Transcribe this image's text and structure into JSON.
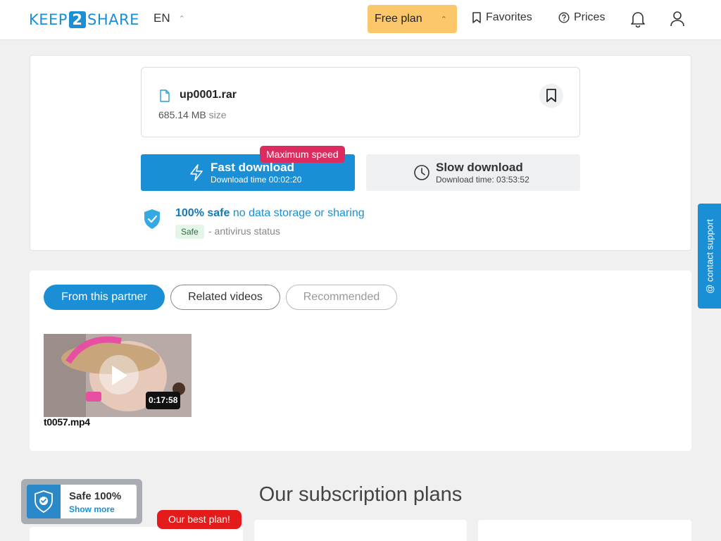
{
  "header": {
    "logo_left": "KEEP",
    "logo_mid": "2",
    "logo_right": "SHARE",
    "language": "EN",
    "plan_label": "Free plan",
    "favorites_label": "Favorites",
    "prices_label": "Prices"
  },
  "file": {
    "name": "up0001.rar",
    "size_value": "685.14 MB",
    "size_unit": "size"
  },
  "download": {
    "fast_title": "Fast download",
    "fast_time": "Download time 00:02:20",
    "max_speed_badge": "Maximum speed",
    "slow_title": "Slow download",
    "slow_time": "Download time: 03:53:52"
  },
  "safety": {
    "safe_bold": "100% safe",
    "safe_rest": "no data storage or sharing",
    "status_tag": "Safe",
    "status_text": "- antivirus status"
  },
  "videos": {
    "tabs": [
      "From this partner",
      "Related videos",
      "Recommended"
    ],
    "items": [
      {
        "title": "t0057.mp4",
        "duration": "0:17:58"
      }
    ]
  },
  "plans": {
    "title": "Our subscription plans",
    "best_badge": "Our best plan!"
  },
  "safe_widget": {
    "title": "Safe 100%",
    "link": "Show more"
  },
  "contact_support": "@ contact support",
  "colors": {
    "brand": "#1a8fd6",
    "plan_button": "#fcc66b",
    "max_speed_badge": "#dc2b5e",
    "best_plan_badge": "#e41b1b"
  }
}
